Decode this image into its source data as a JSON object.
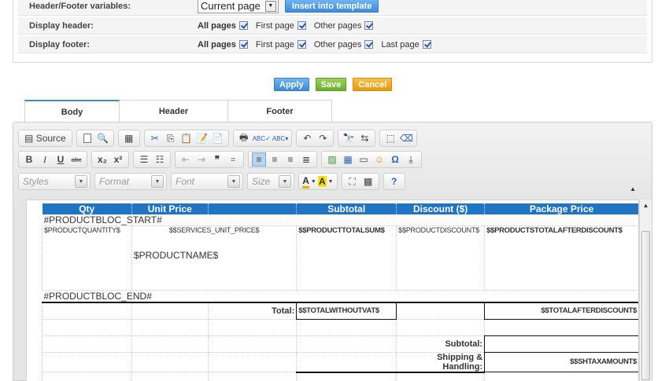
{
  "settings": {
    "variables_label": "Header/Footer variables:",
    "variables_select": "Current page",
    "insert_button": "Insert into template",
    "display_header_label": "Display header:",
    "display_footer_label": "Display footer:",
    "opt_all": "All pages",
    "opt_first": "First page",
    "opt_other": "Other pages",
    "opt_last": "Last page"
  },
  "actions": {
    "apply": "Apply",
    "save": "Save",
    "cancel": "Cancel"
  },
  "tabs": [
    "Body",
    "Header",
    "Footer"
  ],
  "toolbar": {
    "source_label": "Source",
    "styles": "Styles",
    "format": "Format",
    "font": "Font",
    "size": "Size"
  },
  "table": {
    "headers": [
      "Qty",
      "Unit Price",
      "",
      "Subtotal",
      "Discount ($)",
      "Package Price"
    ],
    "bloc_start": "#PRODUCTBLOC_START#",
    "row": [
      "$PRODUCTQUANTITY$",
      "$$SERVICES_UNIT_PRICE$",
      "$$PRODUCTTOTALSUM$",
      "$$PRODUCTDISCOUNT$",
      "$$PRODUCTSTOTALAFTERDISCOUNT$"
    ],
    "product_name": "$PRODUCTNAME$",
    "bloc_end": "#PRODUCTBLOC_END#",
    "total_label": "Total:",
    "total_without_vat": "$$TOTALWITHOUTVAT$",
    "total_after_discount": "$$TOTALAFTERDISCOUNT$",
    "subtotal_label": "Subtotal:",
    "shipping_label": "Shipping & Handling:",
    "sh_tax_amount": "$$SHTAXAMOUNT$"
  }
}
